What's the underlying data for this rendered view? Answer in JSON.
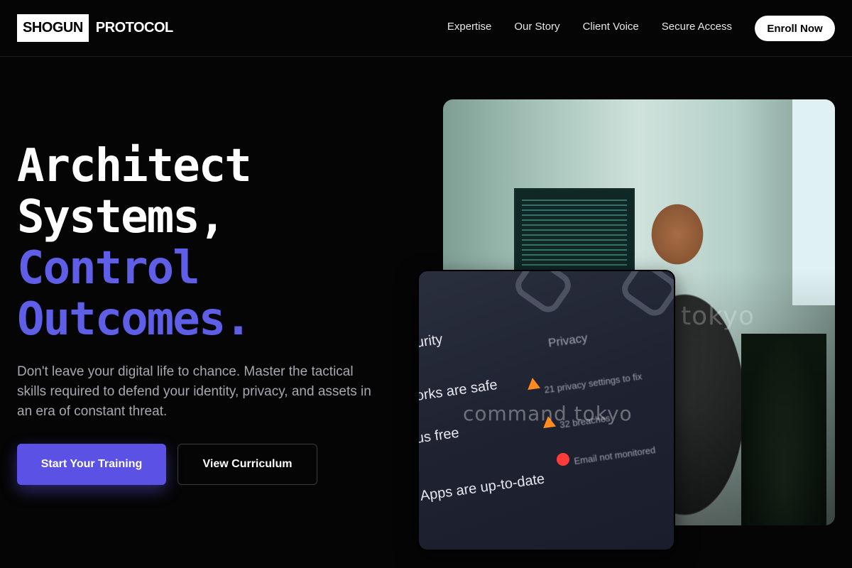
{
  "nav": {
    "logo_box": "SHOGUN",
    "logo_text": "PROTOCOL",
    "links": [
      "Expertise",
      "Our Story",
      "Client Voice",
      "Secure Access"
    ],
    "cta": "Enroll Now"
  },
  "hero": {
    "headline": [
      "Architect",
      "Systems,",
      "Control",
      "Outcomes."
    ],
    "lead": "Don't leave your digital life to chance. Master the tactical skills required to defend your identity, privacy, and assets in an era of constant threat.",
    "primary_button": "Start Your Training",
    "secondary_button": "View Curriculum"
  },
  "images": {
    "back_watermark": "tokyo",
    "front_watermark": "command tokyo",
    "front_lines": [
      "urity",
      "Privacy",
      "orks are safe",
      "21 privacy settings to fix",
      "us free",
      "32 breaches",
      "Email not monitored",
      "Apps are up-to-date"
    ]
  },
  "colors": {
    "accent": "#5f5ee6",
    "primary_button": "#5b51e5",
    "background": "#050505"
  }
}
